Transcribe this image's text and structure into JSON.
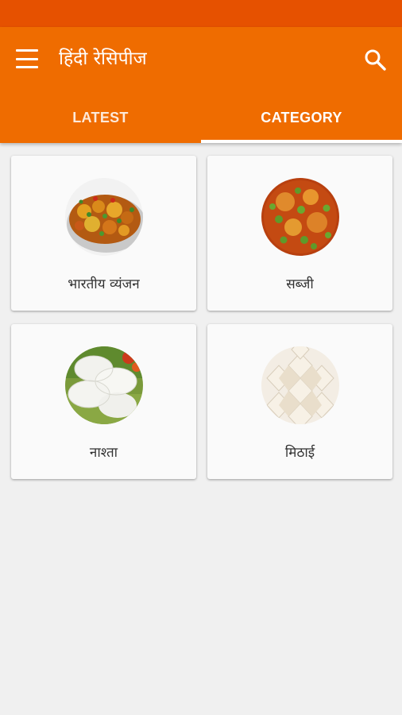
{
  "app": {
    "title": "हिंदी रेसिपीज"
  },
  "icons": {
    "menu": "menu-icon",
    "search": "search-icon"
  },
  "tabs": [
    {
      "label": "LATEST",
      "active": false
    },
    {
      "label": "CATEGORY",
      "active": true
    }
  ],
  "categories": [
    {
      "label": "भारतीय व्यंजन",
      "image": "indian-cuisine-dish-image"
    },
    {
      "label": "सब्जी",
      "image": "sabzi-curry-image"
    },
    {
      "label": "नाश्ता",
      "image": "idli-breakfast-image"
    },
    {
      "label": "मिठाई",
      "image": "kaju-katli-sweets-image"
    }
  ],
  "colors": {
    "status_bar": "#e65100",
    "app_bar": "#ef6c00",
    "background": "#f0f0f0",
    "card": "#fafafa"
  }
}
